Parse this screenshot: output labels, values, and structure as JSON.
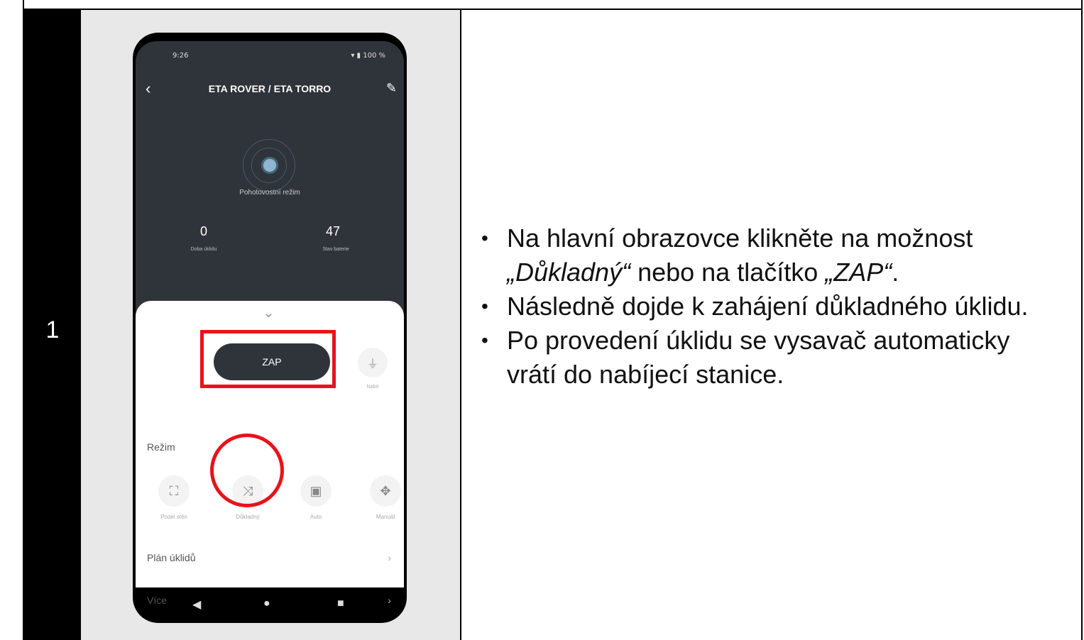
{
  "step": {
    "number": "1"
  },
  "phone": {
    "status_time": "9:26",
    "status_battery": "100 %",
    "title": "ETA ROVER / ETA TORRO",
    "standby_label": "Pohotovostní režim",
    "stats": [
      {
        "value": "0",
        "label": "Doba úklidu"
      },
      {
        "value": "47",
        "label": "Stav baterie"
      }
    ],
    "zap_label": "ZAP",
    "charge_label": "Nabít",
    "mode_heading": "Režim",
    "modes": [
      {
        "label": "Podél stěn",
        "icon": "corners-icon"
      },
      {
        "label": "Důkladný",
        "icon": "shuffle-icon"
      },
      {
        "label": "Auto",
        "icon": "square-icon"
      },
      {
        "label": "Manuál",
        "icon": "move-icon"
      }
    ],
    "rows": [
      {
        "label": "Plán úklidů"
      },
      {
        "label": "Více"
      }
    ]
  },
  "instructions": {
    "b1_pre": "Na hlavní obrazovce klikněte na možnost ",
    "b1_em1": "„Důkladný“",
    "b1_mid": " nebo na tlačítko ",
    "b1_em2": "„ZAP“",
    "b1_post": ".",
    "b2": "Následně dojde k zahájení důkladného úklidu.",
    "b3": "Po provedení úklidu se vysavač automaticky vrátí do nabíjecí stanice."
  },
  "colors": {
    "highlight": "#e8131b",
    "app_dark": "#2f343a"
  }
}
